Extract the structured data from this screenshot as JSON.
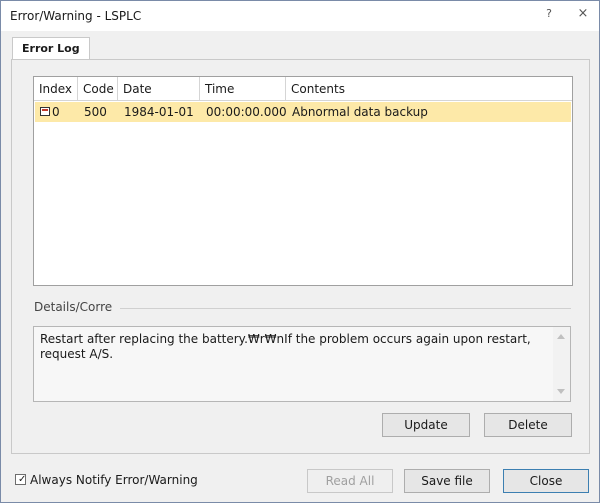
{
  "window": {
    "title": "Error/Warning - LSPLC",
    "help_glyph": "?",
    "close_glyph": "×"
  },
  "tabs": [
    {
      "label": "Error Log",
      "active": true
    }
  ],
  "table": {
    "columns": [
      "Index",
      "Code",
      "Date",
      "Time",
      "Contents"
    ],
    "rows": [
      {
        "index": "0",
        "code": "500",
        "date": "1984-01-01",
        "time": "00:00:00.000",
        "contents": "Abnormal data backup",
        "selected": true
      }
    ]
  },
  "details": {
    "label": "Details/Corre",
    "text": "Restart after replacing the battery.₩r₩nIf the problem occurs again upon restart, request A/S."
  },
  "buttons": {
    "update": "Update",
    "delete": "Delete",
    "read_all": "Read All",
    "save_file": "Save file",
    "close": "Close"
  },
  "checkbox": {
    "label": "Always Notify Error/Warning",
    "checked": true
  },
  "colors": {
    "selected_row": "#fde9a8",
    "window_bg": "#f0f0f0"
  }
}
